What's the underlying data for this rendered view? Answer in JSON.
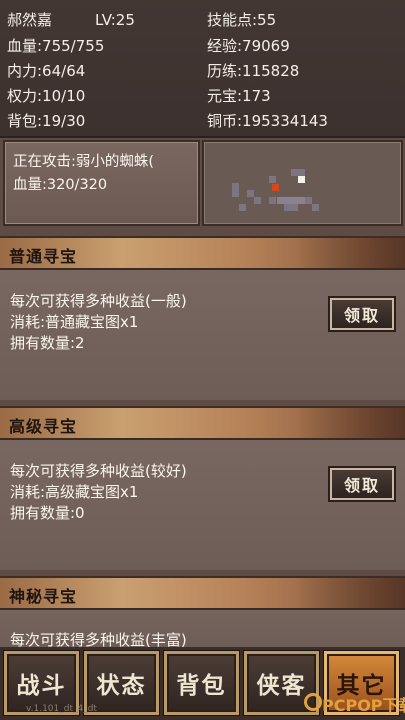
{
  "stats": {
    "name": "郝然嘉",
    "level": "LV:25",
    "skill_points": "技能点:55",
    "hp": "血量:755/755",
    "exp": "经验:79069",
    "inner_power": "内力:64/64",
    "experience": "历练:115828",
    "authority": "权力:10/10",
    "ingots": "元宝:173",
    "bag": "背包:19/30",
    "copper": "铜币:195334143"
  },
  "attack": {
    "target": "正在攻击:弱小的蜘蛛(",
    "target_hp": "血量:320/320"
  },
  "minimap": {
    "player_color": "#d2491f",
    "marker_color": "#f4f0ea"
  },
  "sections": [
    {
      "title": "普通寻宝",
      "desc": "每次可获得多种收益(一般)",
      "cost": "消耗:普通藏宝图x1",
      "count": "拥有数量:2",
      "button": "领取"
    },
    {
      "title": "高级寻宝",
      "desc": "每次可获得多种收益(较好)",
      "cost": "消耗:高级藏宝图x1",
      "count": "拥有数量:0",
      "button": "领取"
    },
    {
      "title": "神秘寻宝",
      "desc": "每次可获得多种收益(丰富)"
    }
  ],
  "nav": {
    "battle": "战斗",
    "status": "状态",
    "bag": "背包",
    "hero": "侠客",
    "other": "其它"
  },
  "version": "v.1.101_dt_4_dt",
  "watermark": "PCPOP下载",
  "colors": {
    "accent_active": "#d58a3a",
    "banner": "#caa070",
    "panel": "#6e5d56"
  }
}
